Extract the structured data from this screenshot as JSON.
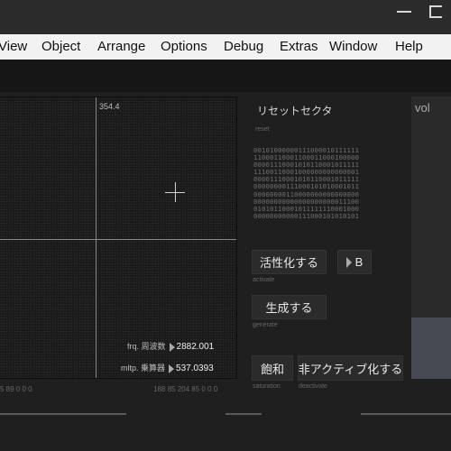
{
  "menubar": {
    "items": [
      "View",
      "Object",
      "Arrange",
      "Options",
      "Debug",
      "Extras",
      "Window",
      "Help"
    ]
  },
  "scope": {
    "coord_label": "354.4",
    "frq_label": "frq. 周波数",
    "frq_value": "2882.001",
    "mltp_label": "mltp. 乗算器",
    "mltp_value": "537.0393",
    "footer_left": "5 89 0 0 0",
    "footer_right": "188 85 204 85 0 0 0"
  },
  "reset_sector": {
    "title": "リセットセクタ",
    "subtitle": "reset",
    "bits": [
      "00101000000111000010111111",
      "11000110001100011000100000",
      "00001110001010110001011111",
      "11100110001000000000000001",
      "00001110001010110001011111",
      "00000000111000101010001011",
      "00000000110000000000000000",
      "00000000000000000000011100",
      "01010110001011111110001000",
      "00000000000111000101010101"
    ]
  },
  "controls": {
    "activate_label": "活性化する",
    "activate_sub": "activate",
    "b_label": "B",
    "generate_label": "生成する",
    "generate_sub": "generate",
    "saturation_label": "飽和",
    "saturation_sub": "saturation",
    "deactivate_label": "非アクティブ化する",
    "deactivate_sub": "deactivate"
  },
  "volume": {
    "label": "vol",
    "level": 0.24,
    "fill_color": "#474a52"
  },
  "colors": {
    "background": "#1a1a1a",
    "menubar": "#f2f2f2",
    "button": "#2b2b2b"
  }
}
